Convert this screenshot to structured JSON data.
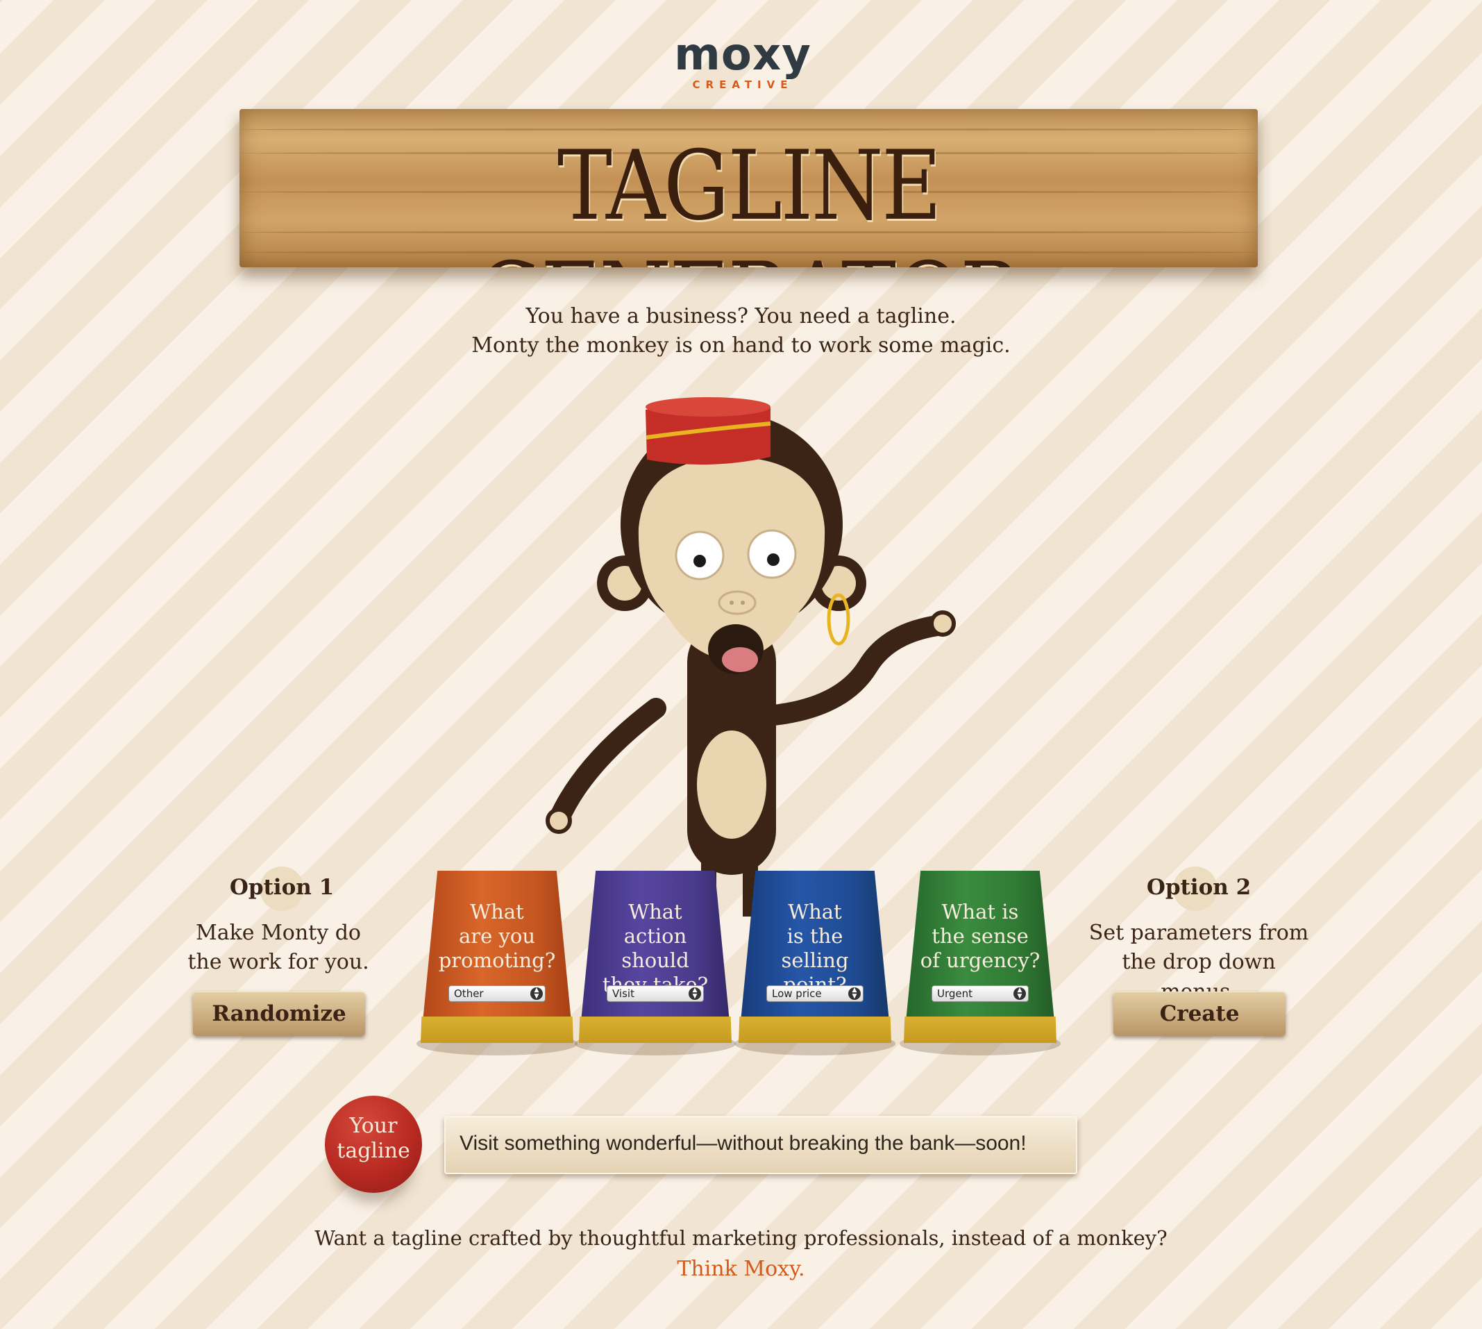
{
  "logo": {
    "word": "moxy",
    "sub": "CREATIVE"
  },
  "header": {
    "title": "TAGLINE GENERATOR"
  },
  "intro": {
    "line1": "You have a business? You need a tagline.",
    "line2": "Monty the monkey is on hand to work some magic."
  },
  "option1": {
    "title": "Option 1",
    "text_line1": "Make Monty do",
    "text_line2": "the work for you.",
    "button": "Randomize"
  },
  "option2": {
    "title": "Option 2",
    "text_line1": "Set parameters from",
    "text_line2": "the drop down menus.",
    "button": "Create"
  },
  "cups": [
    {
      "line1": "What",
      "line2": "are you",
      "line3": "promoting?",
      "selected": "Other",
      "color": "#c95a22"
    },
    {
      "line1": "What",
      "line2": "action should",
      "line3": "they take?",
      "selected": "Visit",
      "color": "#4a3b8c"
    },
    {
      "line1": "What",
      "line2": "is the",
      "line3": "selling point?",
      "selected": "Low price",
      "color": "#1f4b93"
    },
    {
      "line1": "What is",
      "line2": "the sense",
      "line3": "of urgency?",
      "selected": "Urgent",
      "color": "#2f7a34"
    }
  ],
  "result": {
    "label_line1": "Your",
    "label_line2": "tagline",
    "text": "Visit something wonderful—without breaking the bank—soon!"
  },
  "footer": {
    "line": "Want a tagline crafted by thoughtful marketing professionals, instead of a monkey?",
    "link": "Think Moxy",
    "link_suffix": "."
  },
  "colors": {
    "accent": "#d35a1a",
    "monkey_brown": "#3b2416",
    "monkey_face": "#ead5b1",
    "hat_red": "#c42e26",
    "gold": "#e8b420"
  }
}
